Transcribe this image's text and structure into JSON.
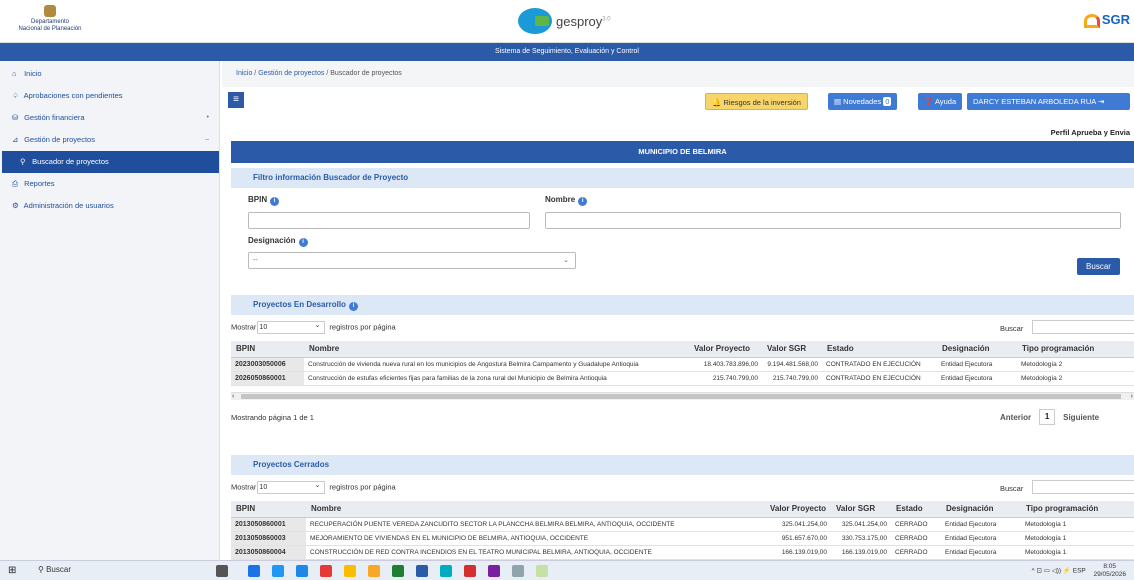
{
  "header": {
    "dnp_line1": "Departamento",
    "dnp_line2": "Nacional de Planeación",
    "gesproy": "gesproy",
    "gesproy_ver": "3.0",
    "sgr": "SGR"
  },
  "system_title": "Sistema de Seguimiento, Evaluación y Control",
  "sidebar": {
    "items": [
      {
        "icon": "⌂",
        "label": "Inicio"
      },
      {
        "icon": "♤",
        "label": "Aprobaciones con pendientes"
      },
      {
        "icon": "⛁",
        "label": "Gestión financiera",
        "arrow": "•"
      },
      {
        "icon": "⊿",
        "label": "Gestión de proyectos",
        "arrow": "–"
      },
      {
        "icon": "⚲",
        "label": "Buscador de proyectos"
      },
      {
        "icon": "⎙",
        "label": "Reportes"
      },
      {
        "icon": "⚙",
        "label": "Administración de usuarios"
      }
    ]
  },
  "breadcrumb": {
    "inicio": "Inicio",
    "sep": "/",
    "gestion": "Gestión de proyectos",
    "current": "/ Buscador de proyectos"
  },
  "toolbar": {
    "menu_icon": "≡",
    "riesgos": "Riesgos de la inversión",
    "novedades": "Novedades",
    "novedades_count": "0",
    "ayuda": "Ayuda",
    "user": "DARCY ESTEBAN ARBOLEDA RUA"
  },
  "perfil": "Perfil Aprueba y Envia",
  "municipio": "MUNICIPIO DE BELMIRA",
  "filter": {
    "title": "Filtro información Buscador de Proyecto",
    "bpin_label": "BPIN",
    "nombre_label": "Nombre",
    "designacion_label": "Designación",
    "designacion_value": "--",
    "buscar": "Buscar",
    "info": "i"
  },
  "desarrollo": {
    "title": "Proyectos En Desarrollo",
    "show": "Mostrar",
    "length": "10",
    "per_page": "registros por página",
    "search": "Buscar",
    "headers": [
      "BPIN",
      "Nombre",
      "Valor Proyecto",
      "Valor SGR",
      "Estado",
      "Designación",
      "Tipo programación"
    ],
    "rows": [
      [
        "2023003050006",
        "Construcción de vivienda nueva rural en los municipios de Angostura Belmira Campamento y Guadalupe Antioquia",
        "18.403.783.896,00",
        "9.194.481.568,00",
        "CONTRATADO EN EJECUCIÓN",
        "Entidad Ejecutora",
        "Metodología 2"
      ],
      [
        "2026050860001",
        "Construcción de estufas eficientes fijas para familias de la zona rural del Municipio de Belmira Antioquia",
        "215.740.799,00",
        "215.740.799,00",
        "CONTRATADO EN EJECUCIÓN",
        "Entidad Ejecutora",
        "Metodología 2"
      ]
    ],
    "page_info": "Mostrando página 1 de 1",
    "prev": "Anterior",
    "page": "1",
    "next": "Siguiente"
  },
  "cerrados": {
    "title": "Proyectos Cerrados",
    "show": "Mostrar",
    "length": "10",
    "per_page": "registros por página",
    "search": "Buscar",
    "headers": [
      "BPIN",
      "Nombre",
      "Valor Proyecto",
      "Valor SGR",
      "Estado",
      "Designación",
      "Tipo programación"
    ],
    "rows": [
      [
        "2013050860001",
        "RECUPERACIÓN PUENTE VEREDA ZANCUDITO SECTOR LA PLANCCHA BELMIRA BELMIRA, ANTIOQUIA, OCCIDENTE",
        "325.041.254,00",
        "325.041.254,00",
        "CERRADO",
        "Entidad Ejecutora",
        "Metodología 1"
      ],
      [
        "2013050860003",
        "MEJORAMIENTO DE VIVIENDAS EN EL MUNICIPIO DE BELMIRA, ANTIOQUIA, OCCIDENTE",
        "951.657.670,00",
        "330.753.175,00",
        "CERRADO",
        "Entidad Ejecutora",
        "Metodología 1"
      ],
      [
        "2013050860004",
        "CONSTRUCCIÓN DE RED CONTRA INCENDIOS EN EL TEATRO MUNICIPAL BELMIRA, ANTIOQUIA, OCCIDENTE",
        "166.139.019,00",
        "166.139.019,00",
        "CERRADO",
        "Entidad Ejecutora",
        "Metodología 1"
      ]
    ]
  },
  "taskbar": {
    "search": "Buscar",
    "lang": "ESP",
    "time": "8:05",
    "date": "29/05/2026"
  }
}
